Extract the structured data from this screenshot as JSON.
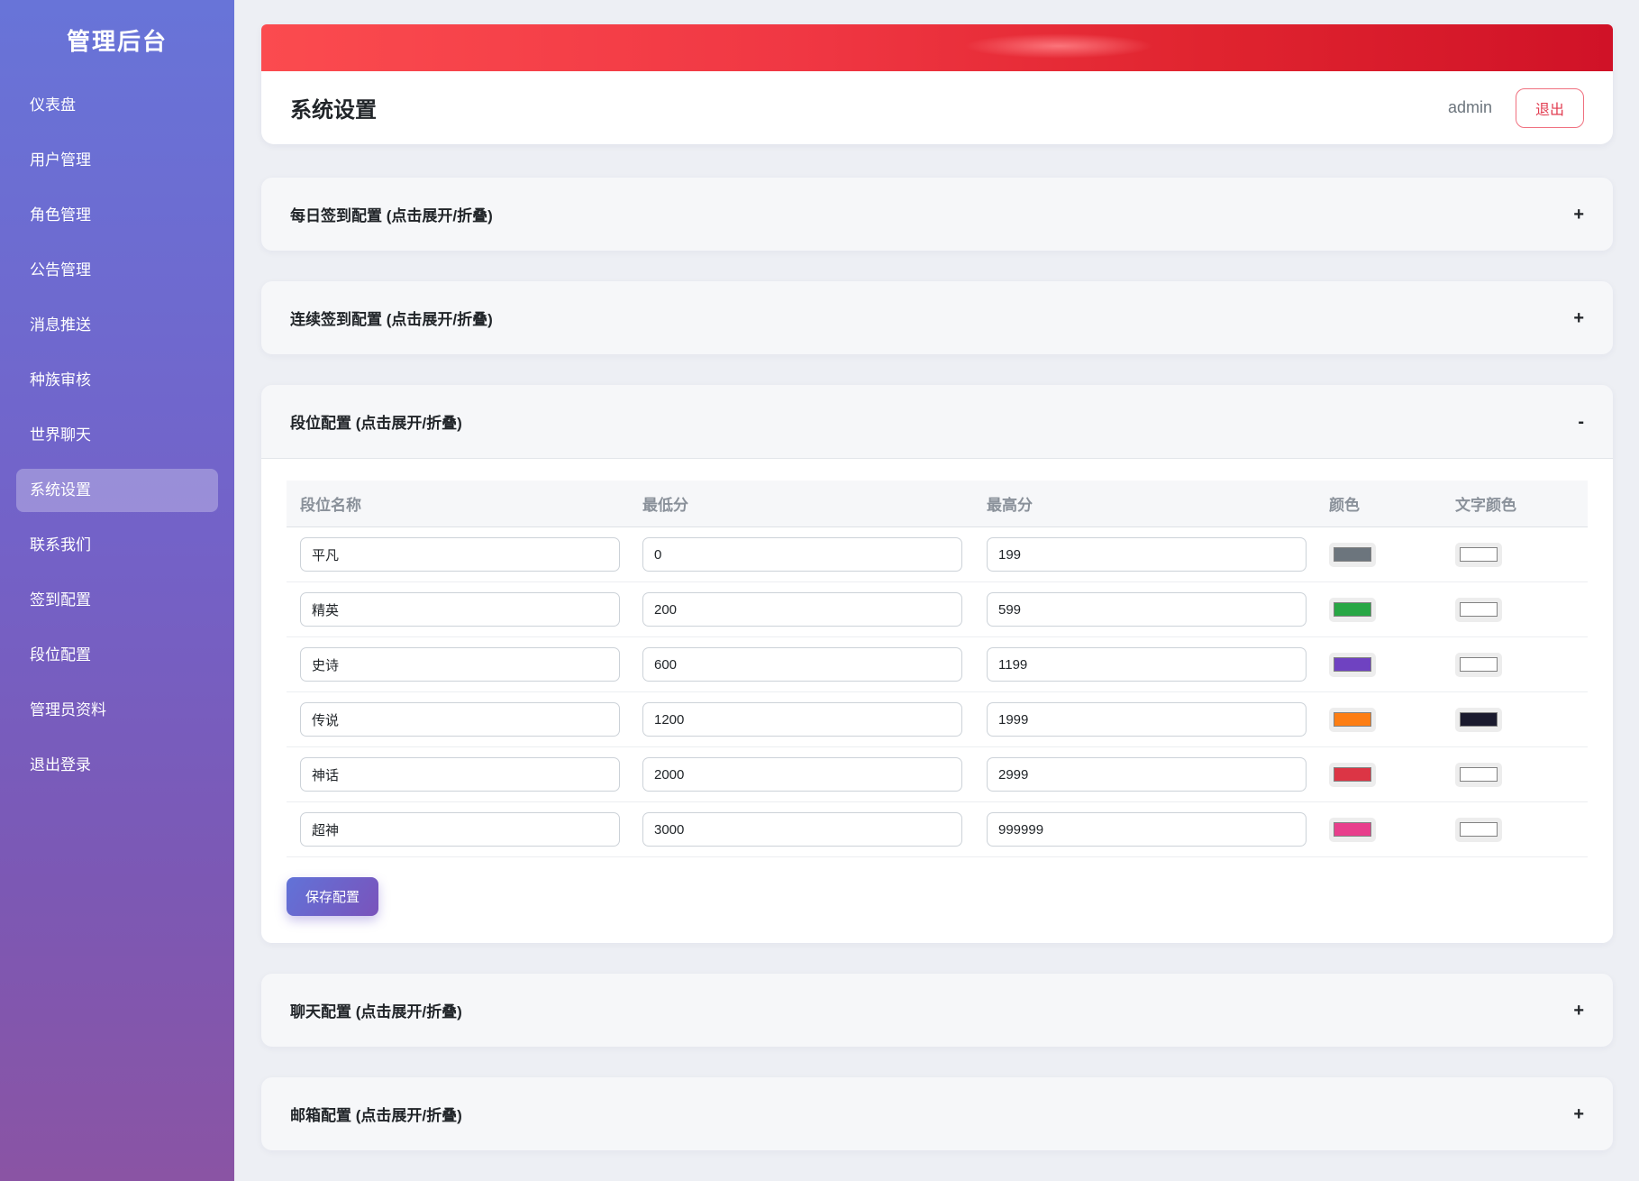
{
  "app": {
    "title": "管理后台"
  },
  "sidebar": {
    "items": [
      {
        "label": "仪表盘"
      },
      {
        "label": "用户管理"
      },
      {
        "label": "角色管理"
      },
      {
        "label": "公告管理"
      },
      {
        "label": "消息推送"
      },
      {
        "label": "种族审核"
      },
      {
        "label": "世界聊天"
      },
      {
        "label": "系统设置"
      },
      {
        "label": "联系我们"
      },
      {
        "label": "签到配置"
      },
      {
        "label": "段位配置"
      },
      {
        "label": "管理员资料"
      },
      {
        "label": "退出登录"
      }
    ]
  },
  "header": {
    "title": "系统设置",
    "username": "admin",
    "logout_label": "退出"
  },
  "sections": [
    {
      "title": "每日签到配置 (点击展开/折叠)",
      "toggle": "+"
    },
    {
      "title": "连续签到配置 (点击展开/折叠)",
      "toggle": "+"
    },
    {
      "title": "段位配置 (点击展开/折叠)",
      "toggle": "-"
    },
    {
      "title": "聊天配置 (点击展开/折叠)",
      "toggle": "+"
    },
    {
      "title": "邮箱配置 (点击展开/折叠)",
      "toggle": "+"
    }
  ],
  "rank_table": {
    "columns": [
      "段位名称",
      "最低分",
      "最高分",
      "颜色",
      "文字颜色"
    ],
    "rows": [
      {
        "name": "平凡",
        "min": "0",
        "max": "199",
        "color": "#6c757d",
        "text_color": "#ffffff"
      },
      {
        "name": "精英",
        "min": "200",
        "max": "599",
        "color": "#28a745",
        "text_color": "#ffffff"
      },
      {
        "name": "史诗",
        "min": "600",
        "max": "1199",
        "color": "#6f42c1",
        "text_color": "#ffffff"
      },
      {
        "name": "传说",
        "min": "1200",
        "max": "1999",
        "color": "#fd7e14",
        "text_color": "#1a1a2e"
      },
      {
        "name": "神话",
        "min": "2000",
        "max": "2999",
        "color": "#dc3545",
        "text_color": "#ffffff"
      },
      {
        "name": "超神",
        "min": "3000",
        "max": "999999",
        "color": "#e83e8c",
        "text_color": "#ffffff"
      }
    ],
    "save_label": "保存配置"
  },
  "colors": {
    "sidebar_gradient_top": "#6874d8",
    "sidebar_gradient_bottom": "#8a54a4",
    "banner_red_left": "#fb4b4f",
    "banner_red_right": "#d01227",
    "accent_logout_red": "#e23c50",
    "save_gradient_left": "#6173d8",
    "save_gradient_right": "#7a53bb"
  }
}
